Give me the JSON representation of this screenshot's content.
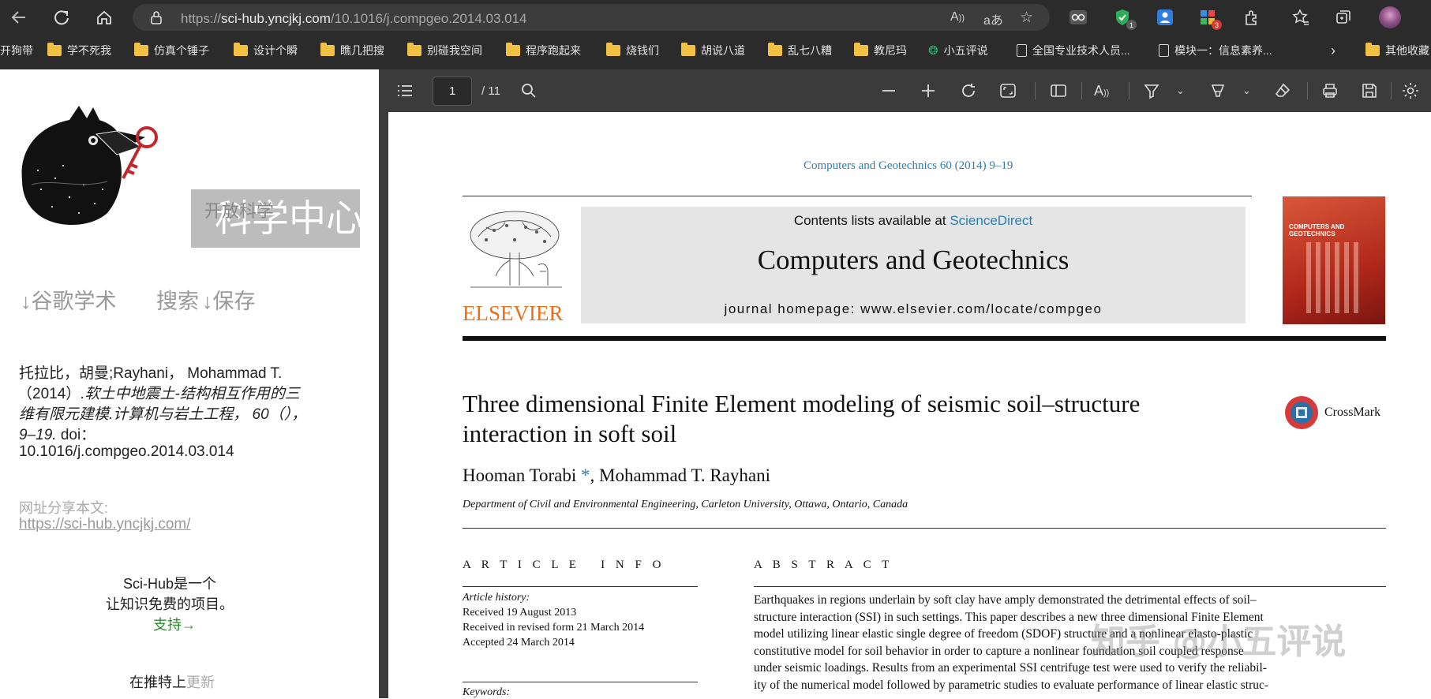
{
  "browser": {
    "url_prefix": "https://",
    "url_domain": "sci-hub.yncjkj.com",
    "url_path": "/10.1016/j.compgeo.2014.03.014",
    "ext_badge_1": "1",
    "ext_badge_3": "3"
  },
  "bookmarks": [
    {
      "label": "开狗带",
      "type": "text"
    },
    {
      "label": "学不死我",
      "type": "folder"
    },
    {
      "label": "仿真个锤子",
      "type": "folder"
    },
    {
      "label": "设计个瞬",
      "type": "folder"
    },
    {
      "label": "瞧几把搜",
      "type": "folder"
    },
    {
      "label": "别碰我空间",
      "type": "folder"
    },
    {
      "label": "程序跑起来",
      "type": "folder"
    },
    {
      "label": "烧钱们",
      "type": "folder"
    },
    {
      "label": "胡说八道",
      "type": "folder"
    },
    {
      "label": "乱七八糟",
      "type": "folder"
    },
    {
      "label": "教尼玛",
      "type": "folder"
    },
    {
      "label": "小五评说",
      "type": "leaf"
    },
    {
      "label": "全国专业技术人员...",
      "type": "doc"
    },
    {
      "label": "模块一：信息素养...",
      "type": "doc"
    },
    {
      "label": "其他收藏",
      "type": "folder"
    }
  ],
  "left": {
    "logo_title": "科学中心",
    "logo_subtitle": "开放科学",
    "nav_scholar": "↓谷歌学术",
    "nav_search": "搜索",
    "nav_save": "↓保存",
    "cite_line1": "托拉比，胡曼;Rayhani， Mohammad T.",
    "cite_line2_plain": "（2014）",
    "cite_line2_italic": ".软土中地震土-结构相互作用的三",
    "cite_line3_italic": "维有限元建模.计算机与岩土工程， 60（），",
    "cite_line4_italic": "9–19.",
    "cite_line4_plain": " doi：",
    "cite_line5": "10.1016/j.compgeo.2014.03.014",
    "share_label": "网址分享本文:",
    "share_link": "https://sci-hub.yncjkj.com/",
    "about_line1": "Sci-Hub是一个",
    "about_line2": "让知识免费的项目。",
    "support_link": "支持→",
    "twitter_text": "在推特上",
    "twitter_link": "更新"
  },
  "pdf_toolbar": {
    "page_current": "1",
    "page_total": "/ 11"
  },
  "pdf": {
    "journal_ref": "Computers and Geotechnics 60 (2014) 9–19",
    "contents_prefix": "Contents lists available at ",
    "contents_link": "ScienceDirect",
    "journal_title": "Computers and Geotechnics",
    "homepage": "journal homepage: www.elsevier.com/locate/compgeo",
    "publisher": "ELSEVIER",
    "cover_text": "COMPUTERS AND GEOTECHNICS",
    "title_line1": "Three dimensional Finite Element modeling of seismic soil–structure",
    "title_line2": "interaction in soft soil",
    "crossmark": "CrossMark",
    "author1": "Hooman Torabi",
    "author_star": " *",
    "author2": ", Mohammad T. Rayhani",
    "affiliation": "Department of Civil and Environmental Engineering, Carleton University, Ottawa, Ontario, Canada",
    "article_info_heading": "A R T I C L E   I N F O",
    "abstract_heading": "A B S T R A C T",
    "history_label": "Article history:",
    "received": "Received 19 August 2013",
    "revised": "Received in revised form 21 March 2014",
    "accepted": "Accepted 24 March 2014",
    "keywords_label": "Keywords:",
    "abstract_lines": [
      "Earthquakes in regions underlain by soft clay have amply demonstrated the detrimental effects of soil–",
      "structure interaction (SSI) in such settings. This paper describes a new three dimensional Finite Element",
      "model utilizing linear elastic single degree of freedom (SDOF) structure and a nonlinear elasto-plastic",
      "constitutive model for soil behavior in order to capture a nonlinear foundation soil coupled response",
      "under seismic loadings. Results from an experimental SSI centrifuge test were used to verify the reliabil-",
      "ity of the numerical model followed by parametric studies to evaluate performance of linear elastic struc-"
    ],
    "watermark": "知乎 @小五评说"
  }
}
